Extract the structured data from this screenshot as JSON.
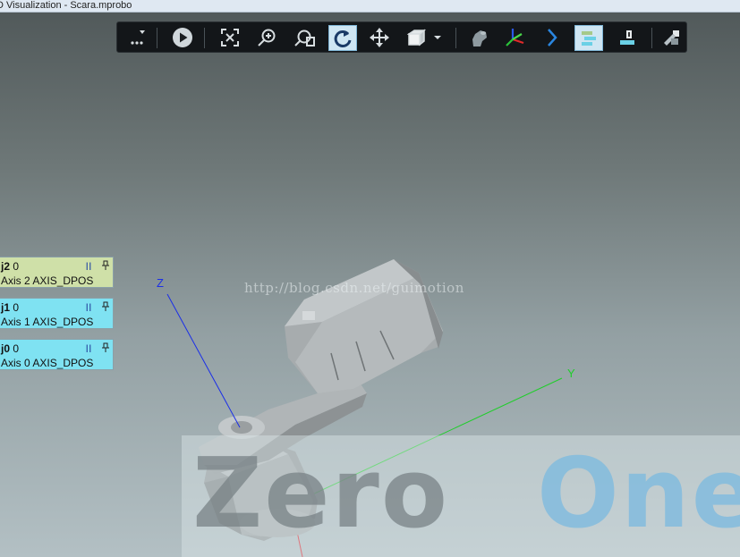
{
  "window": {
    "title": "D Visualization - Scara.mprobo"
  },
  "toolbar": {
    "buttons": [
      {
        "name": "more-menu-icon",
        "active": false
      },
      {
        "name": "play-icon",
        "active": false
      },
      {
        "name": "zoom-fit-icon",
        "active": false
      },
      {
        "name": "zoom-in-icon",
        "active": false
      },
      {
        "name": "zoom-window-icon",
        "active": false
      },
      {
        "name": "rotate-view-icon",
        "active": true
      },
      {
        "name": "pan-icon",
        "active": false
      },
      {
        "name": "view-cube-icon",
        "active": false
      },
      {
        "name": "robot-model-icon",
        "active": false
      },
      {
        "name": "coordinate-axes-icon",
        "active": false
      },
      {
        "name": "chevron-right-icon",
        "active": false
      },
      {
        "name": "joint-panels-icon",
        "active": true
      },
      {
        "name": "tool-icon",
        "active": false
      },
      {
        "name": "settings-wrench-icon",
        "active": false
      }
    ]
  },
  "joint_panels": [
    {
      "name": "j2",
      "value": "0",
      "desc": "Axis 2  AXIS_DPOS",
      "color": "#cfe0a8"
    },
    {
      "name": "j1",
      "value": "0",
      "desc": "Axis 1  AXIS_DPOS",
      "color": "#7fe2f2"
    },
    {
      "name": "j0",
      "value": "0",
      "desc": "Axis 0  AXIS_DPOS",
      "color": "#7fe2f2"
    }
  ],
  "pause_glyph": "||",
  "scene": {
    "axis_z_label": "Z",
    "axis_y_label": "Y",
    "axis_z_color": "#1a2ee8",
    "axis_y_color": "#1fce2a",
    "axis_x_color": "#e0202a"
  },
  "watermark": {
    "url": "http://blog.csdn.net/guimotion",
    "logo_left": "Zero",
    "logo_right": "One"
  }
}
